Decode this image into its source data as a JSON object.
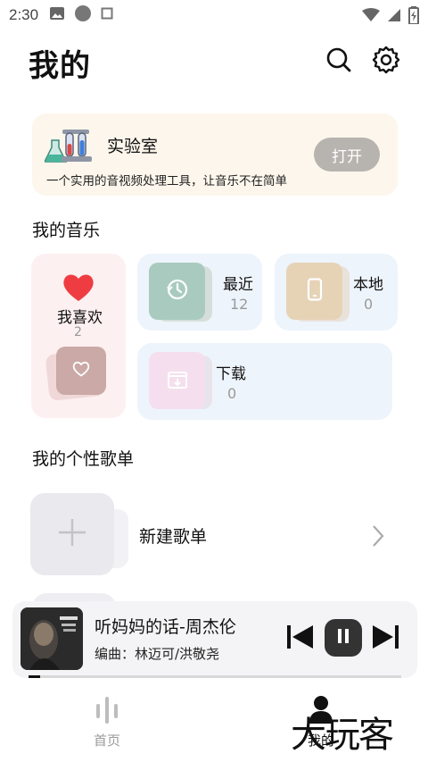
{
  "status_bar": {
    "time": "2:30"
  },
  "header": {
    "title": "我的",
    "search_icon": "search-icon",
    "settings_icon": "gear-icon"
  },
  "lab": {
    "title": "实验室",
    "description": "一个实用的音视频处理工具，让音乐不在简单",
    "open_label": "打开",
    "icon": "lab-flask-icon"
  },
  "my_music": {
    "title": "我的音乐",
    "favorites": {
      "label": "我喜欢",
      "count": "2",
      "accent": "#ef3c42"
    },
    "recent": {
      "label": "最近",
      "count": "12",
      "accent": "#a9cbbf"
    },
    "local": {
      "label": "本地",
      "count": "0",
      "accent": "#e6d3b6"
    },
    "download": {
      "label": "下载",
      "count": "0",
      "accent": "#f5dfee"
    }
  },
  "playlists": {
    "title": "我的个性歌单",
    "new_label": "新建歌单"
  },
  "player": {
    "song": "听妈妈的话-周杰伦",
    "composer": "编曲：林迈可/洪敬尧",
    "progress": 0.03
  },
  "nav": {
    "items": [
      {
        "label": "首页",
        "icon": "home-bars-icon",
        "active": false
      },
      {
        "label": "我的",
        "icon": "profile-icon",
        "active": true
      }
    ]
  },
  "watermark": "大玩客"
}
